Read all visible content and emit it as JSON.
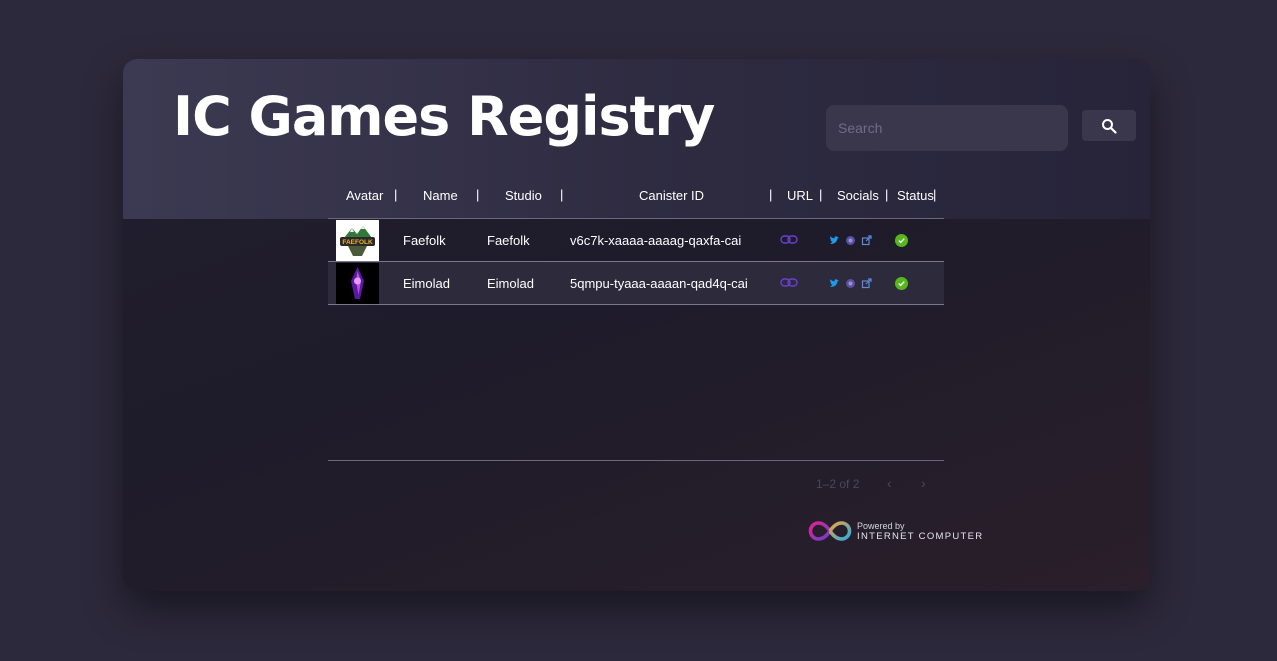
{
  "header": {
    "title": "IC Games Registry",
    "search_placeholder": "Search",
    "search_icon": "search-icon"
  },
  "table": {
    "columns": [
      "Avatar",
      "Name",
      "Studio",
      "Canister ID",
      "URL",
      "Socials",
      "Status"
    ],
    "separator": "|",
    "rows": [
      {
        "avatar": "FAEFOLK",
        "name": "Faefolk",
        "studio": "Faefolk",
        "canister_id": "v6c7k-xaaaa-aaaag-qaxfa-cai",
        "url_icon": "link-icon",
        "socials": [
          "twitter-icon",
          "discord-icon",
          "external-link-icon"
        ],
        "status": "online"
      },
      {
        "avatar": "",
        "name": "Eimolad",
        "studio": "Eimolad",
        "canister_id": "5qmpu-tyaaa-aaaan-qad4q-cai",
        "url_icon": "link-icon",
        "socials": [
          "twitter-icon",
          "discord-icon",
          "external-link-icon"
        ],
        "status": "online"
      }
    ]
  },
  "pagination": {
    "label": "1–2 of 2",
    "prev": "‹",
    "next": "›"
  },
  "footer": {
    "powered_by": "Powered by",
    "brand": "INTERNET COMPUTER"
  },
  "colors": {
    "status_online": "#56b61e",
    "link": "#6a3fd0",
    "twitter": "#1d9bf0",
    "discord": "#7289da"
  }
}
